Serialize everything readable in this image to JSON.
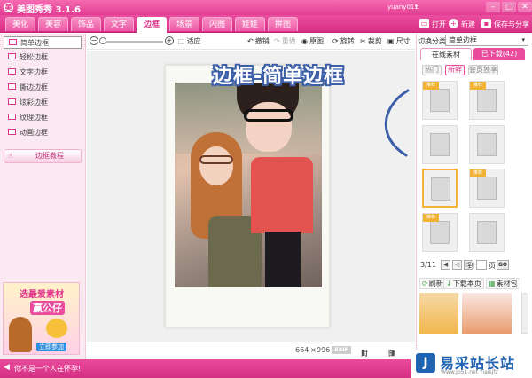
{
  "window": {
    "app_icon_glyph": "美",
    "title": "美图秀秀 3.1.6",
    "user": "yuany011",
    "caret": "▾",
    "min": "–",
    "max": "□",
    "close": "✕"
  },
  "tabs": [
    "美化",
    "美容",
    "饰品",
    "文字",
    "边框",
    "场景",
    "闪图",
    "娃娃",
    "拼图"
  ],
  "active_tab": "边框",
  "top_actions": {
    "open": "打开",
    "new": "新建",
    "save_share": "保存与分享"
  },
  "sidebar": {
    "items": [
      "简单边框",
      "轻松边框",
      "文字边框",
      "撕边边框",
      "炫彩边框",
      "纹理边框",
      "动画边框"
    ],
    "tutorial": "边框教程",
    "tutorial_icon": "☝"
  },
  "ad": {
    "line1": "选最爱素材",
    "line2": "赢公仔",
    "line3": "立即参加"
  },
  "toolbar": {
    "fit": "适应",
    "undo": "撤销",
    "redo": "重做",
    "original": "原图",
    "rotate": "旋转",
    "crop": "裁剪",
    "size": "尺寸"
  },
  "canvas": {
    "banner": "边框-简单边框"
  },
  "image_info": {
    "width": "664",
    "times": "×",
    "height": "996",
    "exif": "EXIF",
    "compare": "对比",
    "preview": "预览"
  },
  "right_panel": {
    "category_label": "切换分类",
    "category_value": "简单边框",
    "tab_online": "在线素材",
    "tab_downloaded": "已下载(42)",
    "sub_hot": "热门",
    "sub_new": "新鲜",
    "sub_vip": "会员独享",
    "ribbon": "推荐",
    "page": "3/11",
    "to_label": "到",
    "page_suffix": "页",
    "go": "GO",
    "refresh": "刷新",
    "download_page": "下载本页",
    "material_pack": "素材包"
  },
  "statusbar": {
    "message": "你不是一个人在怀孕!",
    "speaker": "◀"
  },
  "watermark": {
    "logo": "J",
    "main": "易采站长站",
    "sub": "Www.Jb51.net Yiaisjfz"
  }
}
